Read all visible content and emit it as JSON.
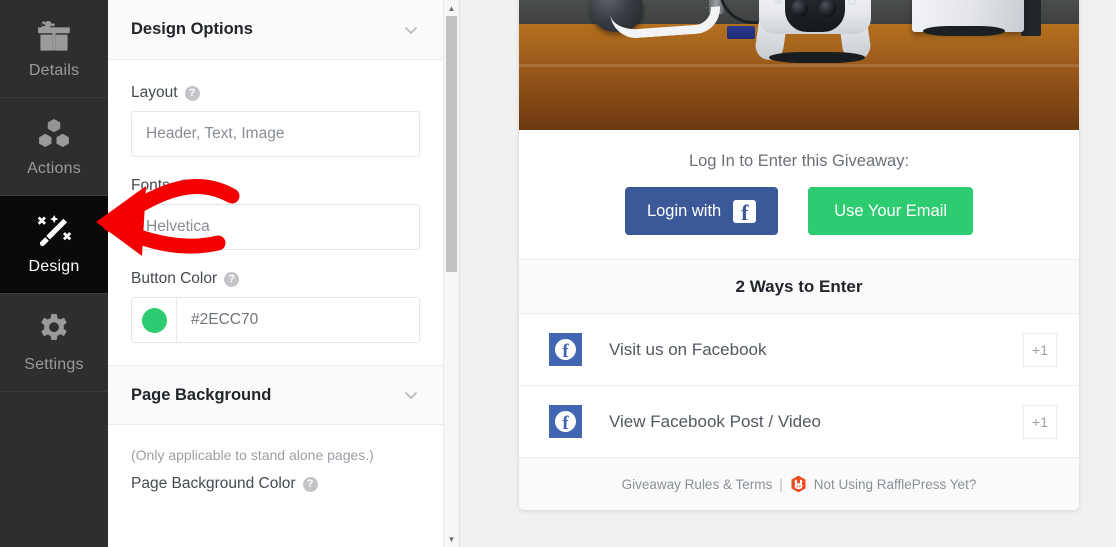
{
  "rail": {
    "items": [
      {
        "label": "Details",
        "icon": "gift-icon",
        "active": false
      },
      {
        "label": "Actions",
        "icon": "cubes-icon",
        "active": false
      },
      {
        "label": "Design",
        "icon": "magic-wand-icon",
        "active": true
      },
      {
        "label": "Settings",
        "icon": "gear-icon",
        "active": false
      }
    ]
  },
  "panel": {
    "sections": [
      {
        "title": "Design Options",
        "expanded": true
      },
      {
        "title": "Page Background",
        "expanded": true
      }
    ],
    "fields": {
      "layout": {
        "label": "Layout",
        "help": "?",
        "value": "Header, Text, Image"
      },
      "fonts": {
        "label": "Fonts",
        "help": "?",
        "value": "Helvetica"
      },
      "button_color": {
        "label": "Button Color",
        "help": "?",
        "value": "#2ECC70",
        "swatch": "#2ECC70"
      },
      "page_background_note": "(Only applicable to stand alone pages.)",
      "page_background_color": {
        "label": "Page Background Color",
        "help": "?"
      }
    }
  },
  "widget": {
    "hero_alt": "ps5-console-photo",
    "login": {
      "title": "Log In to Enter this Giveaway:",
      "facebook_button": "Login with",
      "email_button": "Use Your Email"
    },
    "ways_heading": "2 Ways to Enter",
    "entries": [
      {
        "label": "Visit us on Facebook",
        "points": "+1",
        "icon": "facebook-icon"
      },
      {
        "label": "View Facebook Post / Video",
        "points": "+1",
        "icon": "facebook-icon"
      }
    ],
    "footer": {
      "rules_link": "Giveaway Rules & Terms",
      "separator": "|",
      "logo": "rafflepress-logo",
      "promo_link": "Not Using RafflePress Yet?"
    }
  },
  "colors": {
    "accent_green": "#2ECC70",
    "facebook_blue": "#3b5998",
    "entry_icon_blue": "#4267b2",
    "annotation_red": "#f50000",
    "rail_bg": "#2e2e2e",
    "rail_active_bg": "#0a0a0a"
  },
  "annotation": {
    "type": "hand-drawn-arrow",
    "points_to": "sidebar-item-design"
  }
}
